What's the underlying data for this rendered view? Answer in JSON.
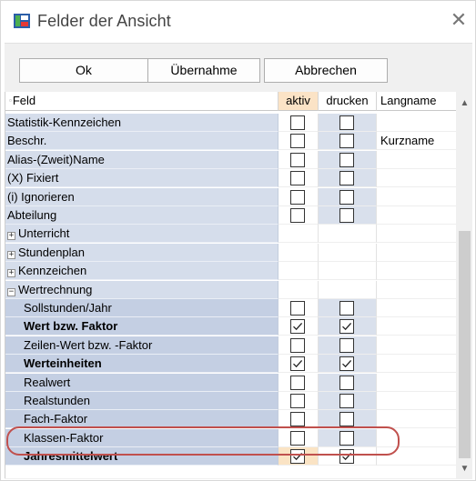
{
  "window": {
    "title": "Felder der Ansicht",
    "close_glyph": "✕"
  },
  "toolbar": {
    "ok_label": "Ok",
    "apply_label": "Übernahme",
    "cancel_label": "Abbrechen"
  },
  "grid": {
    "columns": {
      "feld": "Feld",
      "aktiv": "aktiv",
      "drucken": "drucken",
      "langname": "Langname"
    },
    "rows": [
      {
        "label": "Statistik-Kennzeichen",
        "aktiv": false,
        "drucken": false,
        "langname": ""
      },
      {
        "label": "Beschr.",
        "aktiv": false,
        "drucken": false,
        "langname": "Kurzname"
      },
      {
        "label": "Alias-(Zweit)Name",
        "aktiv": false,
        "drucken": false,
        "langname": ""
      },
      {
        "label": "(X) Fixiert",
        "aktiv": false,
        "drucken": false,
        "langname": ""
      },
      {
        "label": "(i) Ignorieren",
        "aktiv": false,
        "drucken": false,
        "langname": ""
      },
      {
        "label": "Abteilung",
        "aktiv": false,
        "drucken": false,
        "langname": ""
      },
      {
        "label": "Unterricht",
        "group": true,
        "expanded": false
      },
      {
        "label": "Stundenplan",
        "group": true,
        "expanded": false
      },
      {
        "label": "Kennzeichen",
        "group": true,
        "expanded": false
      },
      {
        "label": "Wertrechnung",
        "group": true,
        "expanded": true
      },
      {
        "label": "Sollstunden/Jahr",
        "aktiv": false,
        "drucken": false,
        "langname": ""
      },
      {
        "label": "Wert bzw. Faktor",
        "aktiv": true,
        "drucken": true,
        "langname": "",
        "bold": true
      },
      {
        "label": "Zeilen-Wert bzw. -Faktor",
        "aktiv": false,
        "drucken": false,
        "langname": ""
      },
      {
        "label": "Werteinheiten",
        "aktiv": true,
        "drucken": true,
        "langname": "",
        "bold": true
      },
      {
        "label": "Realwert",
        "aktiv": false,
        "drucken": false,
        "langname": ""
      },
      {
        "label": "Realstunden",
        "aktiv": false,
        "drucken": false,
        "langname": ""
      },
      {
        "label": "Fach-Faktor",
        "aktiv": false,
        "drucken": false,
        "langname": ""
      },
      {
        "label": "Klassen-Faktor",
        "aktiv": false,
        "drucken": false,
        "langname": ""
      },
      {
        "label": "Jahresmittelwert",
        "aktiv": true,
        "drucken": true,
        "langname": "",
        "bold": true,
        "selected": true
      }
    ]
  },
  "colors": {
    "field_column": "#d5ddeb",
    "active_header": "#fbe3c6",
    "highlight_ring": "#c0504d"
  },
  "icons": {
    "app": "view-fields-icon",
    "expand": "+",
    "collapse": "−",
    "scroll_up": "▲",
    "scroll_down": "▼"
  }
}
